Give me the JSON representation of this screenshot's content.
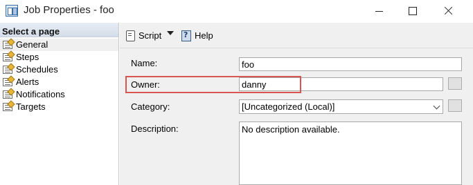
{
  "window": {
    "title": "Job Properties - foo"
  },
  "sidebar": {
    "header": "Select a page",
    "items": [
      {
        "label": "General",
        "selected": true
      },
      {
        "label": "Steps"
      },
      {
        "label": "Schedules"
      },
      {
        "label": "Alerts"
      },
      {
        "label": "Notifications"
      },
      {
        "label": "Targets"
      }
    ]
  },
  "toolbar": {
    "script_label": "Script",
    "help_label": "Help"
  },
  "form": {
    "name_label": "Name:",
    "name_value": "foo",
    "owner_label": "Owner:",
    "owner_value": "danny",
    "category_label": "Category:",
    "category_value": "[Uncategorized (Local)]",
    "description_label": "Description:",
    "description_value": "No description available."
  },
  "colors": {
    "highlight": "#d9534f",
    "panel_bg": "#f0f0f0"
  }
}
